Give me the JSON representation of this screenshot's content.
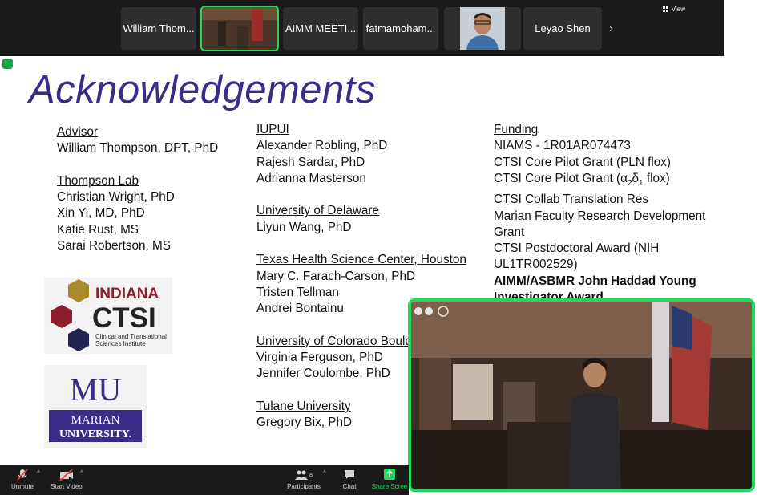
{
  "participants": [
    {
      "name": "William Thom...",
      "type": "name"
    },
    {
      "name": "",
      "type": "video",
      "active": true
    },
    {
      "name": "AIMM MEETI...",
      "type": "name"
    },
    {
      "name": "fatmamoham...",
      "type": "name"
    },
    {
      "name": "",
      "type": "photo"
    },
    {
      "name": "Leyao Shen",
      "type": "name"
    }
  ],
  "view_label": "View",
  "slide": {
    "title": "Acknowledgements",
    "col1": {
      "advisor_heading": "Advisor",
      "advisor": "William Thompson, DPT, PhD",
      "lab_heading": "Thompson Lab",
      "lab_members": [
        "Christian Wright, PhD",
        "Xin Yi, MD, PhD",
        "Katie Rust, MS",
        "Sarai Robertson, MS"
      ]
    },
    "col2": {
      "iupui_heading": "IUPUI",
      "iupui": [
        "Alexander Robling, PhD",
        "Rajesh Sardar, PhD",
        "Adrianna Masterson"
      ],
      "delaware_heading": "University of Delaware",
      "delaware": [
        "Liyun Wang, PhD"
      ],
      "texas_heading": "Texas Health Science Center, Houston",
      "texas": [
        "Mary C. Farach-Carson, PhD",
        "Tristen Tellman",
        "Andrei Bontainu"
      ],
      "colorado_heading": "University of Colorado Boulder",
      "colorado": [
        "Virginia Ferguson, PhD",
        "Jennifer Coulombe, PhD"
      ],
      "tulane_heading": "Tulane University",
      "tulane": [
        "Gregory Bix, PhD"
      ]
    },
    "col3": {
      "funding_heading": "Funding",
      "line1": "NIAMS - 1R01AR074473",
      "line2": "CTSI Core Pilot Grant (PLN flox)",
      "line3_pre": "CTSI Core Pilot Grant (α",
      "line3_sub1": "2",
      "line3_mid": "δ",
      "line3_sub2": "1",
      "line3_post": " flox)",
      "line4": "CTSI Collab Translation Res",
      "line5": "Marian Faculty Research Development",
      "line6": "Grant",
      "line7": "CTSI Postdoctoral Award (NIH",
      "line8": "UL1TR002529)",
      "line9": "AIMM/ASBMR John Haddad Young",
      "line10": "Investigator Award"
    },
    "logo_ctsi": {
      "line1": "INDIANA",
      "line2": "CTSI",
      "line3": "Clinical and Translational",
      "line4": "Sciences Institute"
    },
    "logo_mu": {
      "mark": "MU",
      "line1": "MARIAN",
      "line2": "UNIVERSITY."
    }
  },
  "toolbar": {
    "unmute": "Unmute",
    "start_video": "Start Video",
    "participants": "Participants",
    "participants_count": "8",
    "chat": "Chat",
    "share_screen": "Share Scree"
  },
  "colors": {
    "accent": "#23d959",
    "title": "#3d2b89",
    "toolbar": "#1a1a1a"
  }
}
